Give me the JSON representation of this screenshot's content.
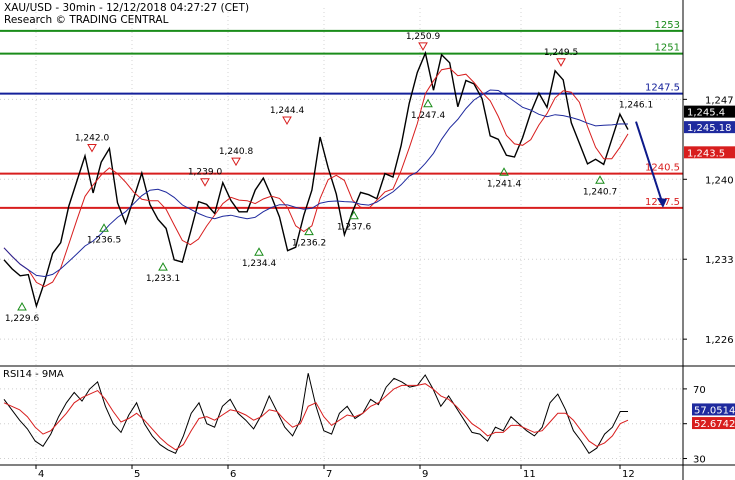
{
  "header": {
    "line1": "XAU/USD - 30min - 12/12/2018 04:27:27 (CET)",
    "line2": "Research © TRADING CENTRAL"
  },
  "colors": {
    "price": "#000000",
    "ma_fast": "#d81e1e",
    "ma_slow": "#1f2a9e",
    "resistance": "#1a8c1a",
    "pivot": "#14209a",
    "support": "#d81e1e",
    "forecast": "#0d1a8a",
    "tag_current": "#000000",
    "tag_ma_slow": "#1f2a9e",
    "tag_ma_fast": "#d81e1e",
    "rsi_line": "#000000",
    "rsi_ma": "#d81e1e"
  },
  "chart_data": [
    {
      "type": "line",
      "ylim": [
        1224,
        1255
      ],
      "y_ticks": [
        "1,226",
        "1,233",
        "1,240",
        "1,247"
      ],
      "x_ticks": [
        "4",
        "5",
        "6",
        "7",
        "9",
        "11",
        "12"
      ],
      "series_price": {
        "x": [
          0,
          2,
          4,
          6,
          8,
          10,
          12,
          14,
          16,
          18,
          20,
          22,
          24,
          26,
          28,
          30,
          32,
          34,
          36,
          38,
          40,
          42,
          44,
          46,
          48,
          50,
          52,
          54,
          56,
          58,
          60,
          62,
          64,
          66,
          68,
          70,
          72,
          74,
          76,
          78,
          80,
          82,
          84,
          86,
          88,
          90,
          92,
          94,
          96,
          98,
          100,
          102,
          104,
          106,
          108,
          110,
          112,
          114,
          116,
          118,
          120,
          122,
          124,
          126,
          128,
          130,
          132,
          134,
          136,
          138,
          140,
          142,
          144,
          146,
          148,
          150,
          152,
          154,
          156,
          158,
          160,
          162,
          164,
          166,
          168,
          170,
          172,
          174,
          176,
          178,
          180,
          182,
          184,
          186,
          188,
          190,
          192,
          194,
          196,
          198,
          200,
          202,
          204,
          206,
          208,
          210,
          212,
          214,
          216,
          218,
          220
        ],
        "values": [
          1234.0,
          1232.5,
          1231.2,
          1230.6,
          1229.6,
          1231.0,
          1232.8,
          1235.5,
          1238.0,
          1239.5,
          1241.0,
          1239.5,
          1241.5,
          1242.0,
          1239.0,
          1236.5,
          1238.0,
          1239.5,
          1238.5,
          1236.5,
          1235.0,
          1234.0,
          1233.1,
          1235.0,
          1237.0,
          1238.5,
          1237.0,
          1239.0,
          1239.2,
          1237.5,
          1236.8,
          1238.0,
          1240.8,
          1238.5,
          1236.0,
          1234.8,
          1234.4,
          1236.5,
          1238.0,
          1244.4,
          1241.0,
          1238.0,
          1236.2,
          1237.5,
          1238.5,
          1237.6,
          1239.0,
          1240.5,
          1239.5,
          1244.0,
          1247.0,
          1249.0,
          1250.0,
          1248.5,
          1250.9,
          1249.5,
          1247.4,
          1249.0,
          1248.0,
          1246.0,
          1244.5,
          1243.5,
          1241.4,
          1243.0,
          1244.0,
          1245.5,
          1246.5,
          1247.0,
          1249.5,
          1248.0,
          1246.0,
          1243.5,
          1241.0,
          1240.7,
          1242.0,
          1243.5,
          1245.0,
          1245.4,
          1245.2,
          1245.3,
          1245.4,
          1245.4,
          1245.4,
          1245.4,
          1245.4,
          1245.4,
          1245.4,
          1245.4,
          1245.4,
          1245.4,
          1245.4,
          1245.4,
          1245.4,
          1245.4,
          1245.4,
          1245.4,
          1245.4,
          1245.4,
          1245.4,
          1245.4,
          1245.4,
          1245.4,
          1245.4,
          1245.4,
          1245.4,
          1245.4,
          1245.4,
          1245.4,
          1245.4,
          1245.4,
          1245.4
        ]
      },
      "levels": [
        {
          "name": "1253",
          "value": 1253.0,
          "kind": "resistance"
        },
        {
          "name": "1251",
          "value": 1251.0,
          "kind": "resistance"
        },
        {
          "name": "1247.5",
          "value": 1247.5,
          "kind": "pivot"
        },
        {
          "name": "1240.5",
          "value": 1240.5,
          "kind": "support"
        },
        {
          "name": "1237.5",
          "value": 1237.5,
          "kind": "support"
        }
      ],
      "annotations": [
        {
          "label": "1,229.6",
          "value": 1229.6,
          "kind": "low"
        },
        {
          "label": "1,242.0",
          "value": 1242.0,
          "kind": "high"
        },
        {
          "label": "1,236.5",
          "value": 1236.5,
          "kind": "low"
        },
        {
          "label": "1,233.1",
          "value": 1233.1,
          "kind": "low"
        },
        {
          "label": "1,239.0",
          "value": 1239.0,
          "kind": "high"
        },
        {
          "label": "1,240.8",
          "value": 1240.8,
          "kind": "high"
        },
        {
          "label": "1,234.4",
          "value": 1234.4,
          "kind": "low"
        },
        {
          "label": "1,244.4",
          "value": 1244.4,
          "kind": "high"
        },
        {
          "label": "1,236.2",
          "value": 1236.2,
          "kind": "low"
        },
        {
          "label": "1,237.6",
          "value": 1237.6,
          "kind": "low"
        },
        {
          "label": "1,250.9",
          "value": 1250.9,
          "kind": "high"
        },
        {
          "label": "1,247.4",
          "value": 1247.4,
          "kind": "low"
        },
        {
          "label": "1,241.4",
          "value": 1241.4,
          "kind": "low"
        },
        {
          "label": "1,249.5",
          "value": 1249.5,
          "kind": "high"
        },
        {
          "label": "1,246.1",
          "value": 1246.1,
          "kind": "level"
        },
        {
          "label": "1,240.7",
          "value": 1240.7,
          "kind": "low"
        }
      ],
      "price_tags": [
        {
          "label": "1,245.4",
          "value": 1245.4,
          "kind": "current"
        },
        {
          "label": "1,245.18",
          "value": 1245.18,
          "kind": "ma_slow"
        },
        {
          "label": "1,243.5",
          "value": 1243.5,
          "kind": "ma_fast"
        }
      ],
      "forecast": {
        "from": 1245.4,
        "to": 1237.5
      }
    },
    {
      "type": "line",
      "title": "RSI14 - 9MA",
      "ylim": [
        28,
        82
      ],
      "y_ticks": [
        "70",
        "50",
        "30"
      ],
      "values": [
        64,
        58,
        52,
        47,
        40,
        37,
        44,
        54,
        62,
        68,
        63,
        70,
        74,
        60,
        50,
        45,
        55,
        62,
        50,
        43,
        38,
        35,
        33,
        43,
        56,
        62,
        50,
        48,
        60,
        64,
        56,
        52,
        47,
        55,
        66,
        57,
        48,
        43,
        52,
        79,
        60,
        46,
        44,
        56,
        60,
        53,
        56,
        64,
        61,
        71,
        76,
        74,
        71,
        72,
        78,
        70,
        60,
        66,
        59,
        52,
        45,
        44,
        40,
        48,
        46,
        54,
        50,
        46,
        43,
        48,
        62,
        67,
        58,
        46,
        40,
        33,
        36,
        44,
        48,
        57,
        57
      ],
      "ma_values": [
        62,
        60,
        58,
        54,
        48,
        44,
        46,
        51,
        56,
        62,
        65,
        67,
        69,
        64,
        57,
        51,
        53,
        56,
        52,
        47,
        42,
        38,
        35,
        38,
        46,
        53,
        54,
        52,
        55,
        58,
        57,
        55,
        52,
        54,
        58,
        57,
        52,
        48,
        50,
        60,
        62,
        54,
        49,
        52,
        55,
        54,
        56,
        60,
        62,
        66,
        70,
        72,
        72,
        72,
        73,
        70,
        66,
        64,
        60,
        55,
        50,
        47,
        43,
        45,
        45,
        49,
        49,
        47,
        45,
        46,
        51,
        56,
        56,
        52,
        46,
        40,
        37,
        39,
        43,
        50,
        52
      ],
      "current_tags": [
        {
          "label": "57.0514",
          "value": 57.0514,
          "kind": "rsi"
        },
        {
          "label": "52.6742",
          "value": 52.6742,
          "kind": "rsi_ma"
        }
      ]
    }
  ]
}
